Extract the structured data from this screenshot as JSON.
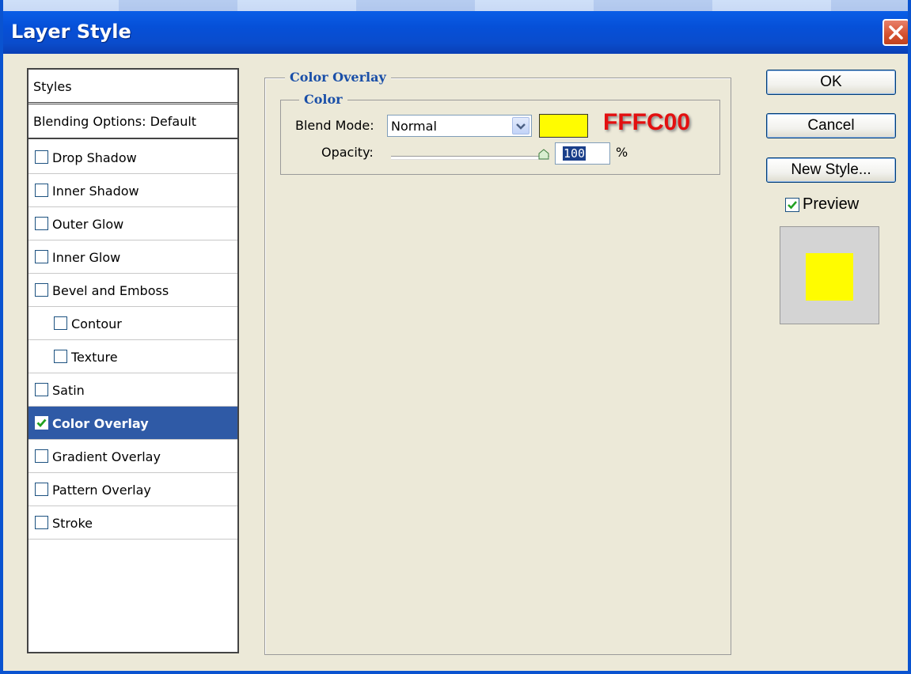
{
  "window": {
    "title": "Layer Style"
  },
  "styles_list": {
    "header": "Styles",
    "blending": "Blending Options: Default",
    "items": [
      {
        "label": "Drop Shadow",
        "checked": false,
        "indent": false
      },
      {
        "label": "Inner Shadow",
        "checked": false,
        "indent": false
      },
      {
        "label": "Outer Glow",
        "checked": false,
        "indent": false
      },
      {
        "label": "Inner Glow",
        "checked": false,
        "indent": false
      },
      {
        "label": "Bevel and Emboss",
        "checked": false,
        "indent": false
      },
      {
        "label": "Contour",
        "checked": false,
        "indent": true
      },
      {
        "label": "Texture",
        "checked": false,
        "indent": true
      },
      {
        "label": "Satin",
        "checked": false,
        "indent": false
      },
      {
        "label": "Color Overlay",
        "checked": true,
        "indent": false,
        "selected": true
      },
      {
        "label": "Gradient Overlay",
        "checked": false,
        "indent": false
      },
      {
        "label": "Pattern Overlay",
        "checked": false,
        "indent": false
      },
      {
        "label": "Stroke",
        "checked": false,
        "indent": false
      }
    ]
  },
  "color_overlay": {
    "section_title": "Color Overlay",
    "group_title": "Color",
    "blend_mode_label": "Blend Mode:",
    "blend_mode_value": "Normal",
    "color_hex": "#FFFC00",
    "annotation": "FFFC00",
    "opacity_label": "Opacity:",
    "opacity_value": "100",
    "opacity_unit": "%",
    "opacity_level": 1.0
  },
  "buttons": {
    "ok": "OK",
    "cancel": "Cancel",
    "new_style": "New Style..."
  },
  "preview": {
    "label": "Preview",
    "checked": true,
    "color": "#FFFC00"
  },
  "colors": {
    "titlebar": "#0650D8",
    "selected_row": "#2F5AA6",
    "section_text": "#1A4FA8",
    "annotation": "#E31010"
  }
}
